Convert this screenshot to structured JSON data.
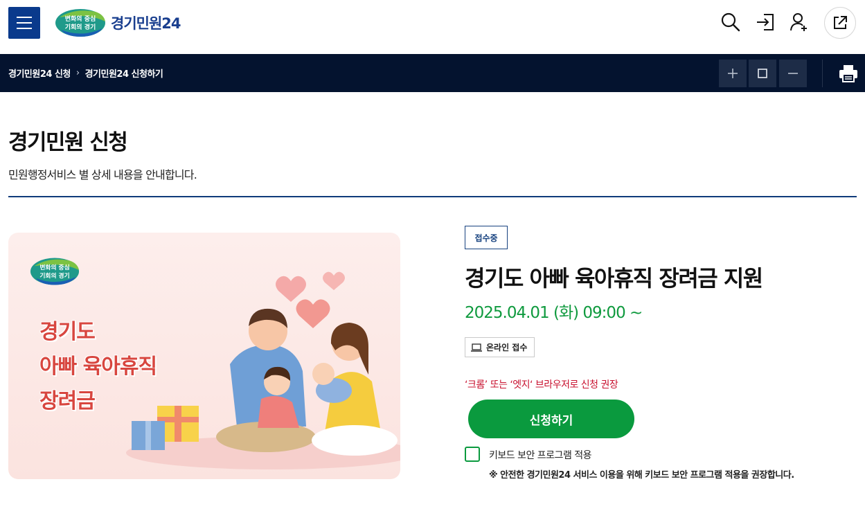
{
  "header": {
    "menu_label": "메뉴",
    "logo_badge_line1": "변화의 중심",
    "logo_badge_line2": "기회의 경기",
    "logo_text": "경기민원24",
    "icons": [
      "search-icon",
      "login-icon",
      "add-user-icon",
      "external-link-icon"
    ]
  },
  "navbar": {
    "breadcrumb": [
      "경기민원24 신청",
      "경기민원24 신청하기"
    ],
    "zoom_icons": [
      "zoom-in-icon",
      "zoom-reset-icon",
      "zoom-out-icon"
    ],
    "print_icon": "print-icon"
  },
  "page": {
    "title": "경기민원 신청",
    "description": "민원행정서비스 별 상세 내용을 안내합니다."
  },
  "banner": {
    "logo_line1": "변화의 중심",
    "logo_line2": "기회의 경기",
    "lines": [
      "경기도",
      "아빠 육아휴직",
      "장려금"
    ]
  },
  "service": {
    "status": "접수중",
    "title": "경기도 아빠 육아휴직 장려금 지원",
    "date": "2025.04.01 (화) 09:00 ~",
    "channel": "온라인 접수",
    "browser_notice": "‘크롬’ 또는 ‘엣지‘ 브라우저로 신청 권장",
    "apply_label": "신청하기",
    "keyboard_security_label": "키보드 보안 프로그램 적용",
    "keyboard_security_checked": false,
    "keyboard_security_note": "※ 안전한 경기민원24 서비스 이용을 위해 키보드 보안 프로그램 적용을 권장합니다."
  },
  "colors": {
    "brand_blue": "#0a3a8c",
    "navbar_bg": "#04132f",
    "accent_green": "#0a9a3e",
    "notice_red": "#c8102e",
    "banner_text_red": "#d8463f"
  }
}
